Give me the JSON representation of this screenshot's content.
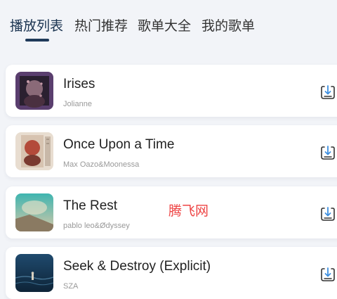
{
  "tabs": [
    {
      "label": "播放列表",
      "active": true
    },
    {
      "label": "热门推荐",
      "active": false
    },
    {
      "label": "歌单大全",
      "active": false
    },
    {
      "label": "我的歌单",
      "active": false
    }
  ],
  "songs": [
    {
      "title": "Irises",
      "artist": "Jolianne",
      "action_icon": "download-icon"
    },
    {
      "title": "Once Upon a Time",
      "artist": "Max Oazo&Moonessa",
      "action_icon": "download-icon"
    },
    {
      "title": "The Rest",
      "artist": "pablo leo&Ødyssey",
      "action_icon": "download-icon"
    },
    {
      "title": "Seek & Destroy (Explicit)",
      "artist": "SZA",
      "action_icon": "download-icon"
    }
  ],
  "watermark": "腾飞网",
  "colors": {
    "background": "#f2f4f8",
    "active_tab": "#1a3350",
    "tab_indicator": "#1f3a5a",
    "download_arrow": "#3d8fe0",
    "watermark": "#ee4444"
  }
}
